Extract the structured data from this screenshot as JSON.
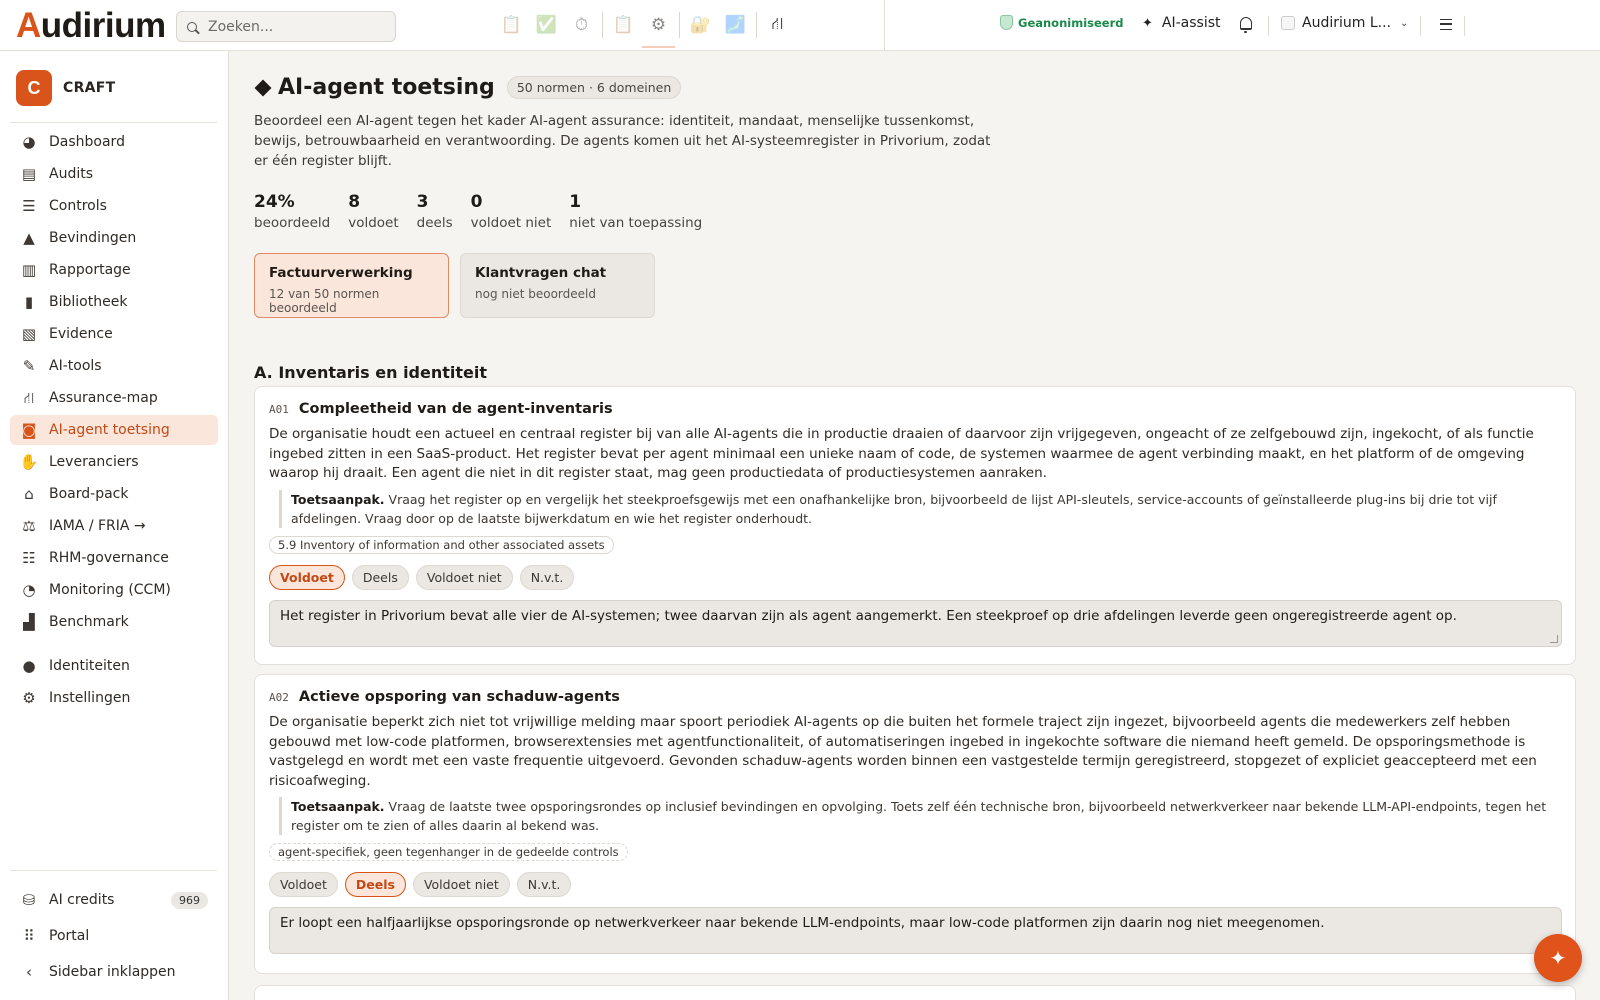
{
  "app": {
    "logo_first": "A",
    "logo_rest": "udirium",
    "search_placeholder": "Zoeken..."
  },
  "topbar": {
    "modes": [
      {
        "icon": "clipboard-icon",
        "glyph": "📋"
      },
      {
        "icon": "check-icon",
        "glyph": "✅"
      },
      {
        "icon": "stopwatch-icon",
        "glyph": "⏱"
      },
      {
        "icon": "clipboard-icon",
        "glyph": "📋"
      },
      {
        "icon": "gear-icon",
        "glyph": "⚙"
      },
      {
        "icon": "lock-icon",
        "glyph": "🔐"
      },
      {
        "icon": "image-icon",
        "glyph": "🗾"
      },
      {
        "icon": "network-icon",
        "glyph": "⛙"
      }
    ],
    "anonymized_label": "Geanonimiseerd",
    "ai_assist_label": "AI-assist",
    "account_label": "Audirium L..."
  },
  "sidebar": {
    "workspace_initial": "C",
    "workspace_name": "CRAFT",
    "items": [
      {
        "label": "Dashboard",
        "icon": "dashboard-icon",
        "glyph": "◕"
      },
      {
        "label": "Audits",
        "icon": "audits-icon",
        "glyph": "▤"
      },
      {
        "label": "Controls",
        "icon": "list-check-icon",
        "glyph": "☰"
      },
      {
        "label": "Bevindingen",
        "icon": "warning-icon",
        "glyph": "▲"
      },
      {
        "label": "Rapportage",
        "icon": "bar-chart-icon",
        "glyph": "▥"
      },
      {
        "label": "Bibliotheek",
        "icon": "book-icon",
        "glyph": "▮"
      },
      {
        "label": "Evidence",
        "icon": "file-shield-icon",
        "glyph": "▧"
      },
      {
        "label": "AI-tools",
        "icon": "magic-wand-icon",
        "glyph": "✎"
      },
      {
        "label": "Assurance-map",
        "icon": "network-icon",
        "glyph": "⛙"
      },
      {
        "label": "AI-agent toetsing",
        "icon": "robot-icon",
        "glyph": "◙",
        "active": true
      },
      {
        "label": "Leveranciers",
        "icon": "handshake-icon",
        "glyph": "✋"
      },
      {
        "label": "Board-pack",
        "icon": "bank-icon",
        "glyph": "⌂"
      },
      {
        "label": "IAMA / FRIA →",
        "icon": "scale-icon",
        "glyph": "⚖"
      },
      {
        "label": "RHM-governance",
        "icon": "sliders-icon",
        "glyph": "☷"
      },
      {
        "label": "Monitoring (CCM)",
        "icon": "gauge-icon",
        "glyph": "◔"
      },
      {
        "label": "Benchmark",
        "icon": "podium-icon",
        "glyph": "▟"
      }
    ],
    "items2": [
      {
        "label": "Identiteiten",
        "icon": "user-icon",
        "glyph": "●"
      },
      {
        "label": "Instellingen",
        "icon": "gear-icon",
        "glyph": "⚙"
      }
    ],
    "bottom": [
      {
        "label": "AI credits",
        "icon": "coins-icon",
        "glyph": "⛁",
        "badge": "969"
      },
      {
        "label": "Portal",
        "icon": "grid-icon",
        "glyph": "⠿"
      },
      {
        "label": "Sidebar inklappen",
        "icon": "chevron-left-icon",
        "glyph": "‹"
      }
    ]
  },
  "page": {
    "title": "AI-agent toetsing",
    "badge": "50 normen · 6 domeinen",
    "intro": "Beoordeel een AI-agent tegen het kader AI-agent assurance: identiteit, mandaat, menselijke tussenkomst, bewijs, betrouwbaarheid en verantwoording. De agents komen uit het AI-systeemregister in Privorium, zodat er één register blijft.",
    "stats": [
      {
        "value": "24%",
        "label": "beoordeeld"
      },
      {
        "value": "8",
        "label": "voldoet"
      },
      {
        "value": "3",
        "label": "deels"
      },
      {
        "value": "0",
        "label": "voldoet niet"
      },
      {
        "value": "1",
        "label": "niet van toepassing"
      }
    ],
    "agents": [
      {
        "name": "Factuurverwerking",
        "sub": "12 van 50 normen beoordeeld",
        "selected": true
      },
      {
        "name": "Klantvragen chat",
        "sub": "nog niet beoordeeld",
        "selected": false
      }
    ],
    "section_title": "A. Inventaris en identiteit",
    "verdict_labels": [
      "Voldoet",
      "Deels",
      "Voldoet niet",
      "N.v.t."
    ],
    "norms": [
      {
        "code": "A01",
        "title": "Compleetheid van de agent-inventaris",
        "description": "De organisatie houdt een actueel en centraal register bij van alle AI-agents die in productie draaien of daarvoor zijn vrijgegeven, ongeacht of ze zelfgebouwd zijn, ingekocht, of als functie ingebed zitten in een SaaS-product. Het register bevat per agent minimaal een unieke naam of code, de systemen waarmee de agent verbinding maakt, en het platform of de omgeving waarop hij draait. Een agent die niet in dit register staat, mag geen productiedata of productiesystemen aanraken.",
        "approach_label": "Toetsaanpak.",
        "approach": "Vraag het register op en vergelijk het steekproefsgewijs met een onafhankelijke bron, bijvoorbeeld de lijst API-sleutels, service-accounts of geïnstalleerde plug-ins bij drie tot vijf afdelingen. Vraag door op de laatste bijwerkdatum en wie het register onderhoudt.",
        "reference": "5.9 Inventory of information and other associated assets",
        "selected_verdict": 0,
        "note": "Het register in Privorium bevat alle vier de AI-systemen; twee daarvan zijn als agent aangemerkt. Een steekproef op drie afdelingen leverde geen ongeregistreerde agent op."
      },
      {
        "code": "A02",
        "title": "Actieve opsporing van schaduw-agents",
        "description": "De organisatie beperkt zich niet tot vrijwillige melding maar spoort periodiek AI-agents op die buiten het formele traject zijn ingezet, bijvoorbeeld agents die medewerkers zelf hebben gebouwd met low-code platformen, browserextensies met agentfunctionaliteit, of automatiseringen ingebed in ingekochte software die niemand heeft gemeld. De opsporingsmethode is vastgelegd en wordt met een vaste frequentie uitgevoerd. Gevonden schaduw-agents worden binnen een vastgestelde termijn geregistreerd, stopgezet of expliciet geaccepteerd met een risicoafweging.",
        "approach_label": "Toetsaanpak.",
        "approach": "Vraag de laatste twee opsporingsrondes op inclusief bevindingen en opvolging. Toets zelf één technische bron, bijvoorbeeld netwerkverkeer naar bekende LLM-API-endpoints, tegen het register om te zien of alles daarin al bekend was.",
        "reference": "agent-specifiek, geen tegenhanger in de gedeelde controls",
        "selected_verdict": 1,
        "note": "Er loopt een halfjaarlijkse opsporingsronde op netwerkverkeer naar bekende LLM-endpoints, maar low-code platformen zijn daarin nog niet meegenomen."
      }
    ]
  },
  "colors": {
    "accent": "#d9541a",
    "accent_light": "#fbe6dc",
    "success": "#1a8a4a"
  }
}
